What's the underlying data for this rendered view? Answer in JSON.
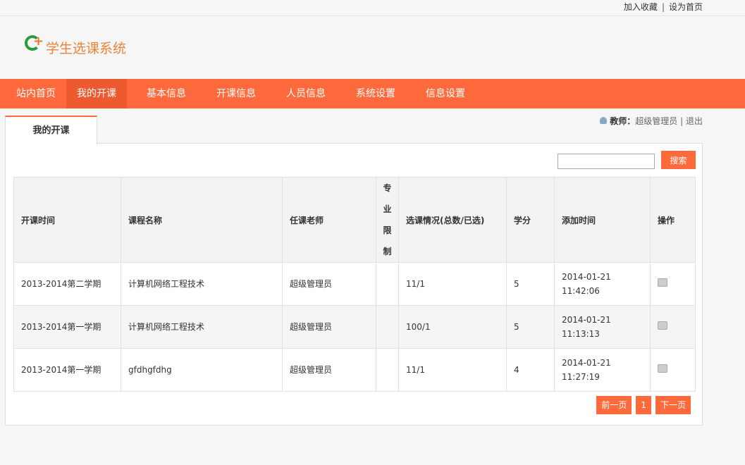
{
  "topbar": {
    "favorite": "加入收藏",
    "sep": "|",
    "homepage": "设为首页"
  },
  "logo": {
    "text": "学生选课系统"
  },
  "nav": [
    "站内首页",
    "我的开课",
    "基本信息",
    "开课信息",
    "人员信息",
    "系统设置",
    "信息设置"
  ],
  "tab": "我的开课",
  "user": {
    "role": "教师：",
    "name": "超级管理员",
    "sep": "|",
    "logout": "退出"
  },
  "search": {
    "value": "",
    "button": "搜索"
  },
  "table": {
    "headers": [
      "开课时间",
      "课程名称",
      "任课老师",
      "专业限制",
      "选课情况(总数/已选)",
      "学分",
      "添加时间",
      "操作"
    ],
    "rows": [
      {
        "term": "2013-2014第二学期",
        "course": "计算机网络工程技术",
        "teacher": "超级管理员",
        "major": "",
        "status": "11/1",
        "credit": "5",
        "date": "2014-01-21",
        "time": "11:42:06"
      },
      {
        "term": "2013-2014第一学期",
        "course": "计算机网络工程技术",
        "teacher": "超级管理员",
        "major": "",
        "status": "100/1",
        "credit": "5",
        "date": "2014-01-21",
        "time": "11:13:13"
      },
      {
        "term": "2013-2014第一学期",
        "course": "gfdhgfdhg",
        "teacher": "超级管理员",
        "major": "",
        "status": "11/1",
        "credit": "4",
        "date": "2014-01-21",
        "time": "11:27:19"
      }
    ]
  },
  "pager": {
    "prev": "前一页",
    "current": "1",
    "next": "下一页"
  }
}
